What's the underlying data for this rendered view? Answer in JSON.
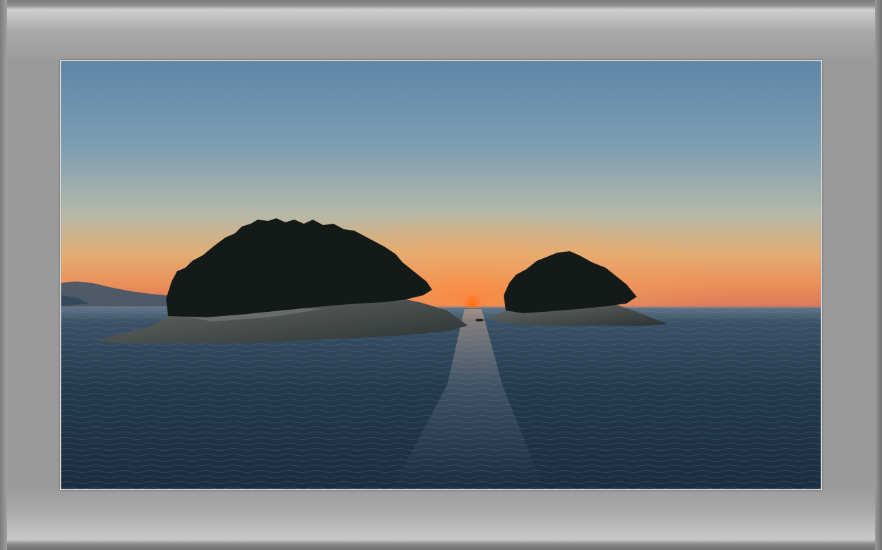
{
  "photo": {
    "subject": "sunset-over-sea-with-two-islands",
    "colors": {
      "sky_top": "#5f87a8",
      "sky_mid": "#9fb3b6",
      "sky_glow": "#e8a560",
      "horizon": "#e06a3c",
      "sun": "#ff7a1a",
      "sea": "#1e3447",
      "island": "#141a18",
      "rock": "#4f5656",
      "mat": "#9a9a9a",
      "border": "#f2f2f2"
    }
  }
}
